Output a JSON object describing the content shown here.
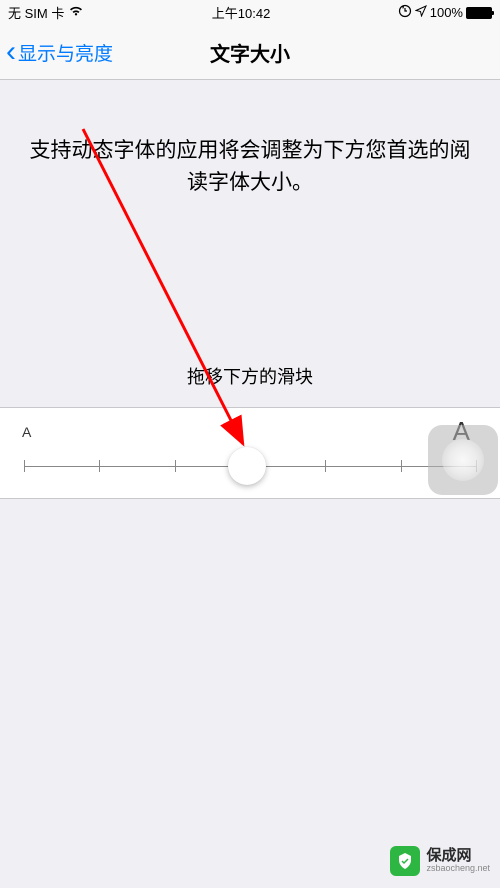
{
  "status_bar": {
    "carrier": "无 SIM 卡",
    "time": "上午10:42",
    "battery_percent": "100%"
  },
  "nav": {
    "back_label": "显示与亮度",
    "title": "文字大小"
  },
  "content": {
    "description": "支持动态字体的应用将会调整为下方您首选的阅读字体大小。",
    "slider_instruction": "拖移下方的滑块",
    "small_letter": "A",
    "large_letter": "A"
  },
  "slider": {
    "ticks": 7,
    "value_index": 3
  },
  "watermark": {
    "brand": "保成网",
    "url": "zsbaocheng.net"
  }
}
